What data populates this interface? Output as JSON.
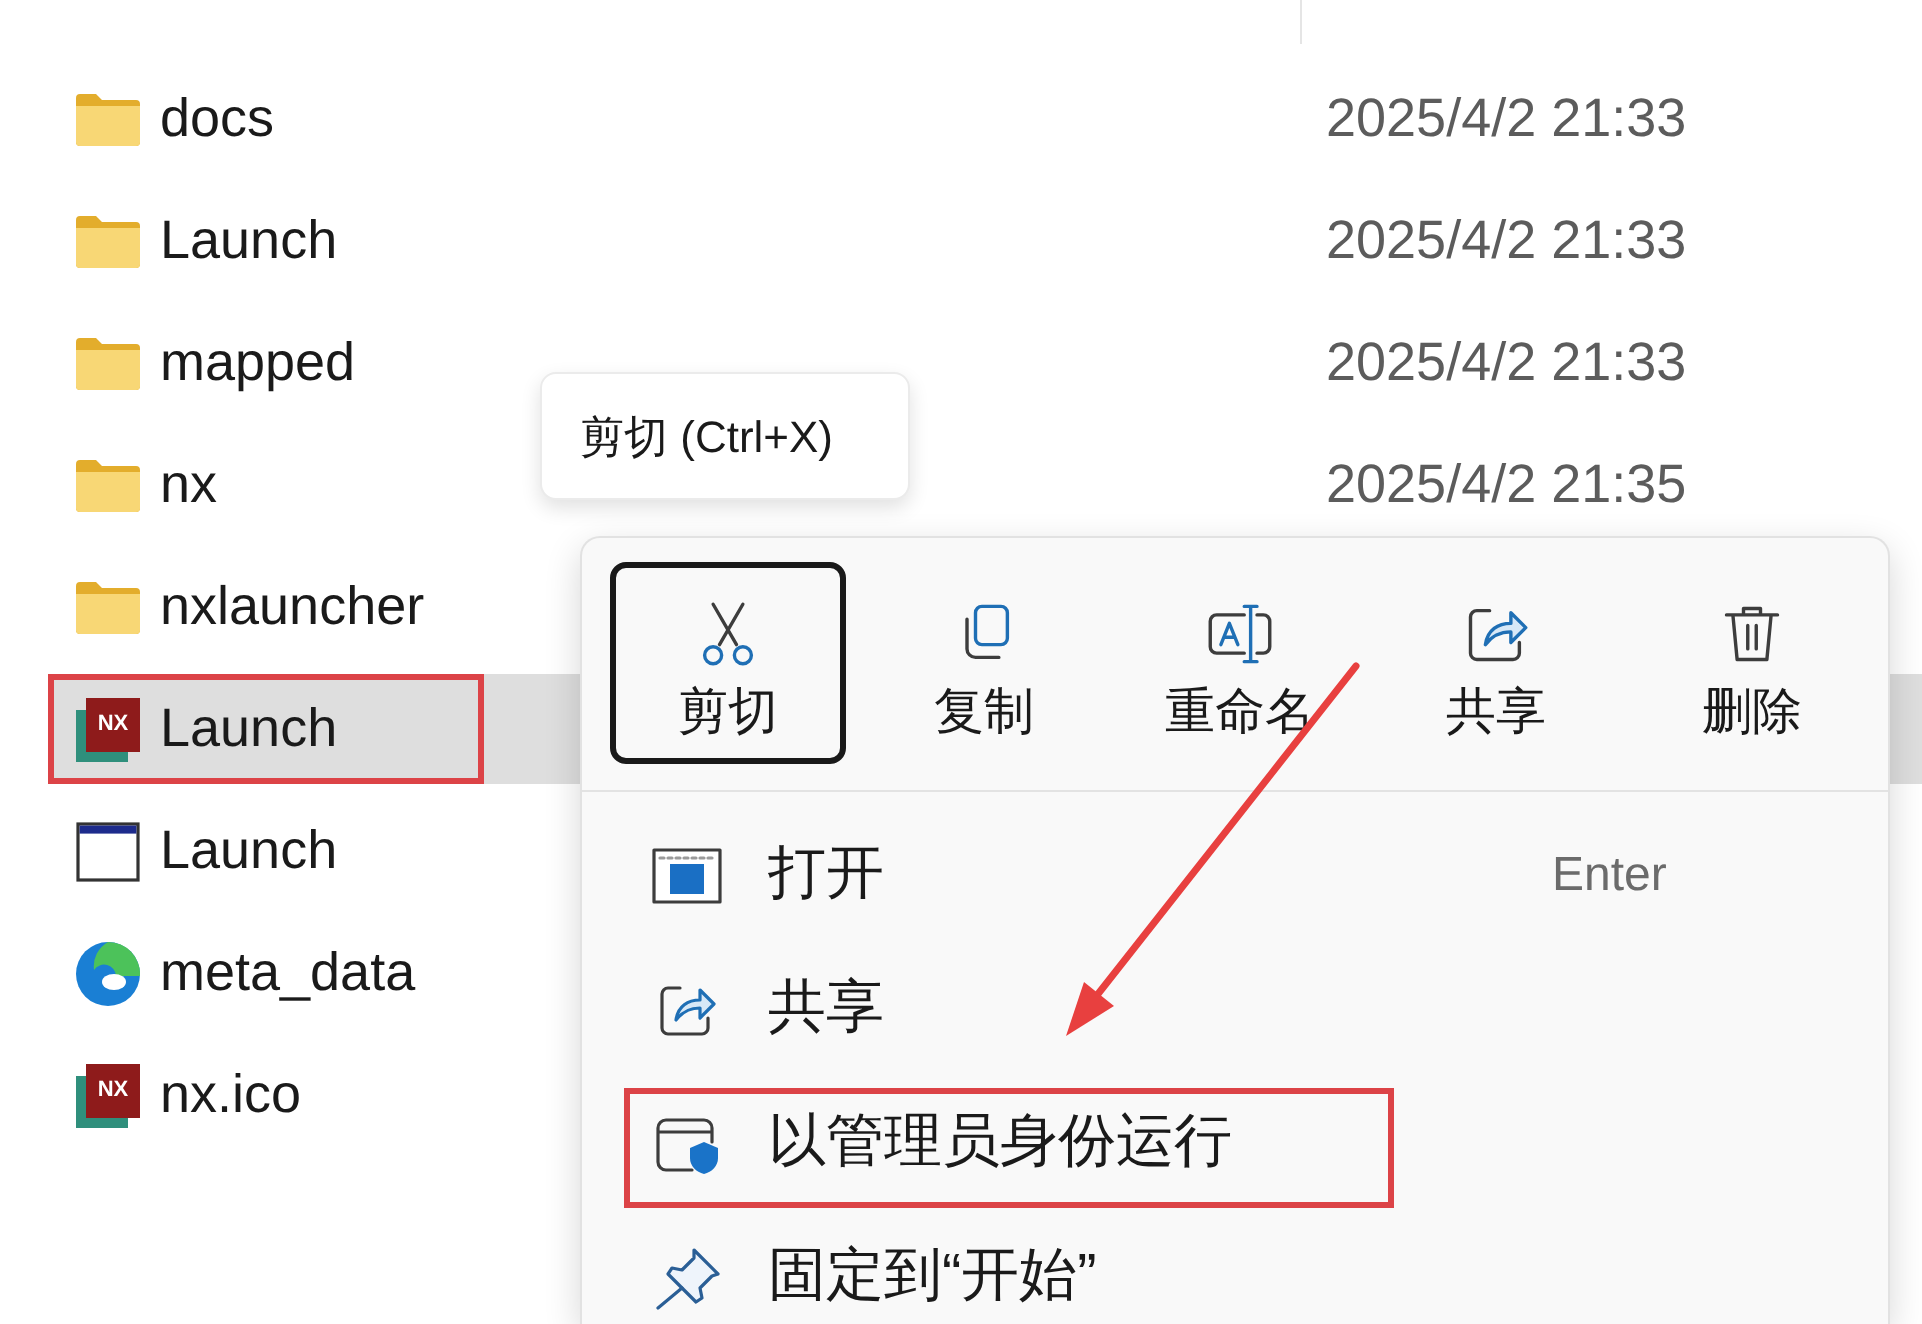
{
  "file_list": {
    "rows": [
      {
        "name": "docs",
        "modified": "2025/4/2 21:33",
        "kind": "folder",
        "selected": false,
        "annotated": false
      },
      {
        "name": "Launch",
        "modified": "2025/4/2 21:33",
        "kind": "folder",
        "selected": false,
        "annotated": false
      },
      {
        "name": "mapped",
        "modified": "2025/4/2 21:33",
        "kind": "folder",
        "selected": false,
        "annotated": false
      },
      {
        "name": "nx",
        "modified": "2025/4/2 21:35",
        "kind": "folder",
        "selected": false,
        "annotated": false
      },
      {
        "name": "nxlauncher",
        "kind": "folder",
        "selected": false,
        "annotated": false
      },
      {
        "name": "Launch",
        "kind": "logo",
        "badge": "NX",
        "selected": true,
        "annotated": true
      },
      {
        "name": "Launch",
        "kind": "window",
        "selected": false,
        "annotated": false
      },
      {
        "name": "meta_data",
        "kind": "browser",
        "selected": false,
        "annotated": false
      },
      {
        "name": "nx.ico",
        "kind": "logo",
        "badge": "NX",
        "selected": false,
        "annotated": false
      }
    ]
  },
  "tooltip": {
    "text": "剪切 (Ctrl+X)"
  },
  "context_menu": {
    "toolbar": [
      {
        "label": "剪切",
        "kind": "cut",
        "focused": true
      },
      {
        "label": "复制",
        "kind": "copy",
        "focused": false
      },
      {
        "label": "重命名",
        "kind": "rename",
        "focused": false
      },
      {
        "label": "共享",
        "kind": "share",
        "focused": false
      },
      {
        "label": "删除",
        "kind": "delete",
        "focused": false
      }
    ],
    "items": [
      {
        "label": "打开",
        "shortcut": "Enter",
        "kind": "open",
        "annotated": false
      },
      {
        "label": "共享",
        "kind": "share",
        "annotated": false
      },
      {
        "label": "以管理员身份运行",
        "kind": "admin",
        "annotated": true
      },
      {
        "label": "固定到“开始”",
        "kind": "pin",
        "annotated": false
      }
    ]
  }
}
